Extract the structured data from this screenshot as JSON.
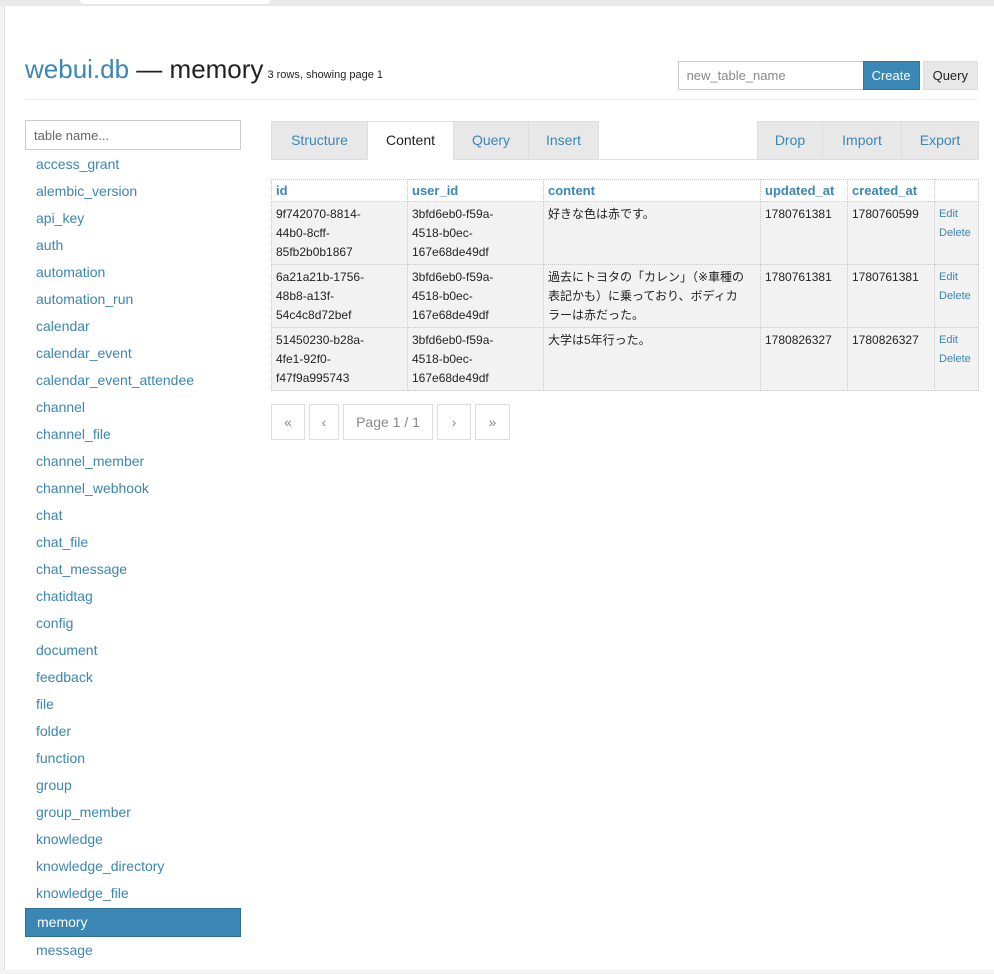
{
  "header": {
    "db_name": "webui.db",
    "separator": " — ",
    "table_name": "memory",
    "row_info": "3 rows, showing page 1"
  },
  "create_form": {
    "placeholder": "new_table_name",
    "create_label": "Create",
    "query_label": "Query"
  },
  "sidebar": {
    "search_placeholder": "table name...",
    "items": [
      "access_grant",
      "alembic_version",
      "api_key",
      "auth",
      "automation",
      "automation_run",
      "calendar",
      "calendar_event",
      "calendar_event_attendee",
      "channel",
      "channel_file",
      "channel_member",
      "channel_webhook",
      "chat",
      "chat_file",
      "chat_message",
      "chatidtag",
      "config",
      "document",
      "feedback",
      "file",
      "folder",
      "function",
      "group",
      "group_member",
      "knowledge",
      "knowledge_directory",
      "knowledge_file",
      "memory",
      "message"
    ],
    "active_item": "memory"
  },
  "tabs": {
    "structure": "Structure",
    "content": "Content",
    "query": "Query",
    "insert": "Insert",
    "drop": "Drop",
    "import": "Import",
    "export": "Export",
    "active": "Content"
  },
  "table": {
    "columns": [
      "id",
      "user_id",
      "content",
      "updated_at",
      "created_at"
    ],
    "action_edit": "Edit",
    "action_delete": "Delete",
    "rows": [
      {
        "id": [
          "9f742070-8814-",
          "44b0-8cff-",
          "85fb2b0b1867"
        ],
        "user_id": [
          "3bfd6eb0-f59a-",
          "4518-b0ec-",
          "167e68de49df"
        ],
        "content": [
          "好きな色は赤です。"
        ],
        "updated_at": "1780761381",
        "created_at": "1780760599"
      },
      {
        "id": [
          "6a21a21b-1756-",
          "48b8-a13f-",
          "54c4c8d72bef"
        ],
        "user_id": [
          "3bfd6eb0-f59a-",
          "4518-b0ec-",
          "167e68de49df"
        ],
        "content": [
          "過去にトヨタの「カレン」（※車種の",
          "表記かも）に乗っており、ボディカ",
          "ラーは赤だった。"
        ],
        "updated_at": "1780761381",
        "created_at": "1780761381"
      },
      {
        "id": [
          "51450230-b28a-",
          "4fe1-92f0-",
          "f47f9a995743"
        ],
        "user_id": [
          "3bfd6eb0-f59a-",
          "4518-b0ec-",
          "167e68de49df"
        ],
        "content": [
          "大学は5年行った。"
        ],
        "updated_at": "1780826327",
        "created_at": "1780826327"
      }
    ]
  },
  "pager": {
    "first": "«",
    "prev": "‹",
    "page_label": "Page 1 / 1",
    "next": "›",
    "last": "»"
  },
  "colors": {
    "accent": "#3a86b5",
    "tab_bg": "#e8e8e8",
    "row_bg": "#f2f2f2"
  }
}
